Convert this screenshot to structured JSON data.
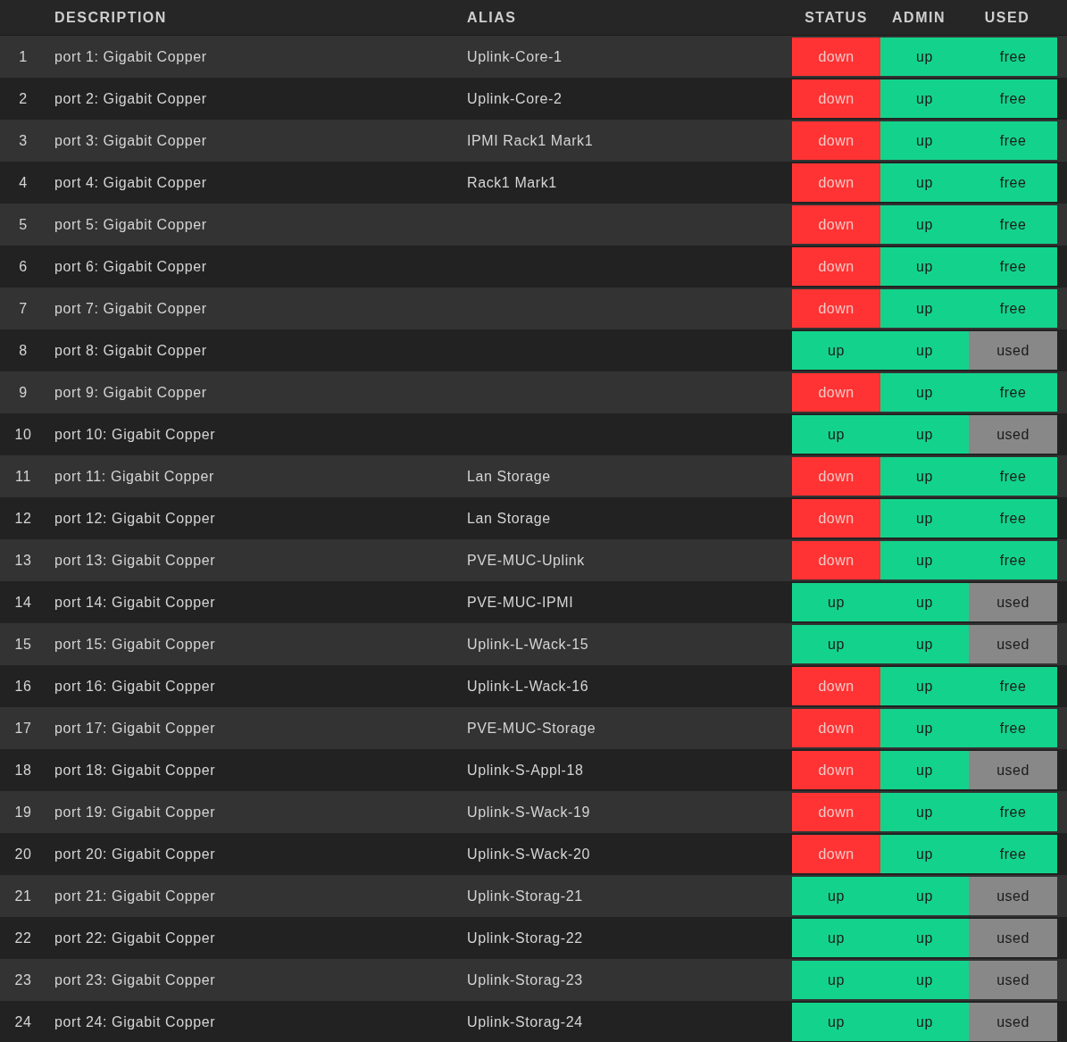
{
  "table": {
    "columns": [
      "DESCRIPTION",
      "ALIAS",
      "STATUS",
      "ADMIN",
      "USED"
    ],
    "rows": [
      {
        "index": "1",
        "description": "port 1: Gigabit Copper",
        "alias": "Uplink-Core-1",
        "status": "down",
        "link_up": false,
        "admin": "up",
        "admin_up": true,
        "used": "free",
        "in_use": false
      },
      {
        "index": "2",
        "description": "port 2: Gigabit Copper",
        "alias": "Uplink-Core-2",
        "status": "down",
        "link_up": false,
        "admin": "up",
        "admin_up": true,
        "used": "free",
        "in_use": false
      },
      {
        "index": "3",
        "description": "port 3: Gigabit Copper",
        "alias": "IPMI Rack1 Mark1",
        "status": "down",
        "link_up": false,
        "admin": "up",
        "admin_up": true,
        "used": "free",
        "in_use": false
      },
      {
        "index": "4",
        "description": "port 4: Gigabit Copper",
        "alias": "Rack1 Mark1",
        "status": "down",
        "link_up": false,
        "admin": "up",
        "admin_up": true,
        "used": "free",
        "in_use": false
      },
      {
        "index": "5",
        "description": "port 5: Gigabit Copper",
        "status": "down",
        "link_up": false,
        "admin": "up",
        "admin_up": true,
        "used": "free",
        "in_use": false
      },
      {
        "index": "6",
        "description": "port 6: Gigabit Copper",
        "status": "down",
        "link_up": false,
        "admin": "up",
        "admin_up": true,
        "used": "free",
        "in_use": false
      },
      {
        "index": "7",
        "description": "port 7: Gigabit Copper",
        "status": "down",
        "link_up": false,
        "admin": "up",
        "admin_up": true,
        "used": "free",
        "in_use": false
      },
      {
        "index": "8",
        "description": "port 8: Gigabit Copper",
        "status": "up",
        "link_up": true,
        "admin": "up",
        "admin_up": true,
        "used": "used",
        "in_use": true
      },
      {
        "index": "9",
        "description": "port 9: Gigabit Copper",
        "status": "down",
        "link_up": false,
        "admin": "up",
        "admin_up": true,
        "used": "free",
        "in_use": false
      },
      {
        "index": "10",
        "description": "port 10: Gigabit Copper",
        "status": "up",
        "link_up": true,
        "admin": "up",
        "admin_up": true,
        "used": "used",
        "in_use": true
      },
      {
        "index": "11",
        "description": "port 11: Gigabit Copper",
        "alias": "Lan Storage",
        "status": "down",
        "link_up": false,
        "admin": "up",
        "admin_up": true,
        "used": "free",
        "in_use": false
      },
      {
        "index": "12",
        "description": "port 12: Gigabit Copper",
        "alias": "Lan Storage",
        "status": "down",
        "link_up": false,
        "admin": "up",
        "admin_up": true,
        "used": "free",
        "in_use": false
      },
      {
        "index": "13",
        "description": "port 13: Gigabit Copper",
        "alias": "PVE-MUC-Uplink",
        "status": "down",
        "link_up": false,
        "admin": "up",
        "admin_up": true,
        "used": "free",
        "in_use": false
      },
      {
        "index": "14",
        "description": "port 14: Gigabit Copper",
        "alias": "PVE-MUC-IPMI",
        "status": "up",
        "link_up": true,
        "admin": "up",
        "admin_up": true,
        "used": "used",
        "in_use": true
      },
      {
        "index": "15",
        "description": "port 15: Gigabit Copper",
        "alias": "Uplink-L-Wack-15",
        "status": "up",
        "link_up": true,
        "admin": "up",
        "admin_up": true,
        "used": "used",
        "in_use": true
      },
      {
        "index": "16",
        "description": "port 16: Gigabit Copper",
        "alias": "Uplink-L-Wack-16",
        "status": "down",
        "link_up": false,
        "admin": "up",
        "admin_up": true,
        "used": "free",
        "in_use": false
      },
      {
        "index": "17",
        "description": "port 17: Gigabit Copper",
        "alias": "PVE-MUC-Storage",
        "status": "down",
        "link_up": false,
        "admin": "up",
        "admin_up": true,
        "used": "free",
        "in_use": false
      },
      {
        "index": "18",
        "description": "port 18: Gigabit Copper",
        "alias": "Uplink-S-Appl-18",
        "status": "down",
        "link_up": false,
        "admin": "up",
        "admin_up": true,
        "used": "used",
        "in_use": true
      },
      {
        "index": "19",
        "description": "port 19: Gigabit Copper",
        "alias": "Uplink-S-Wack-19",
        "status": "down",
        "link_up": false,
        "admin": "up",
        "admin_up": true,
        "used": "free",
        "in_use": false
      },
      {
        "index": "20",
        "description": "port 20: Gigabit Copper",
        "alias": "Uplink-S-Wack-20",
        "status": "down",
        "link_up": false,
        "admin": "up",
        "admin_up": true,
        "used": "free",
        "in_use": false
      },
      {
        "index": "21",
        "description": "port 21: Gigabit Copper",
        "alias": "Uplink-Storag-21",
        "status": "up",
        "link_up": true,
        "admin": "up",
        "admin_up": true,
        "used": "used",
        "in_use": true
      },
      {
        "index": "22",
        "description": "port 22: Gigabit Copper",
        "alias": "Uplink-Storag-22",
        "status": "up",
        "link_up": true,
        "admin": "up",
        "admin_up": true,
        "used": "used",
        "in_use": true
      },
      {
        "index": "23",
        "description": "port 23: Gigabit Copper",
        "alias": "Uplink-Storag-23",
        "status": "up",
        "link_up": true,
        "admin": "up",
        "admin_up": true,
        "used": "used",
        "in_use": true
      },
      {
        "index": "24",
        "description": "port 24: Gigabit Copper",
        "alias": "Uplink-Storag-24",
        "status": "up",
        "link_up": true,
        "admin": "up",
        "admin_up": true,
        "used": "used",
        "in_use": true
      }
    ]
  }
}
